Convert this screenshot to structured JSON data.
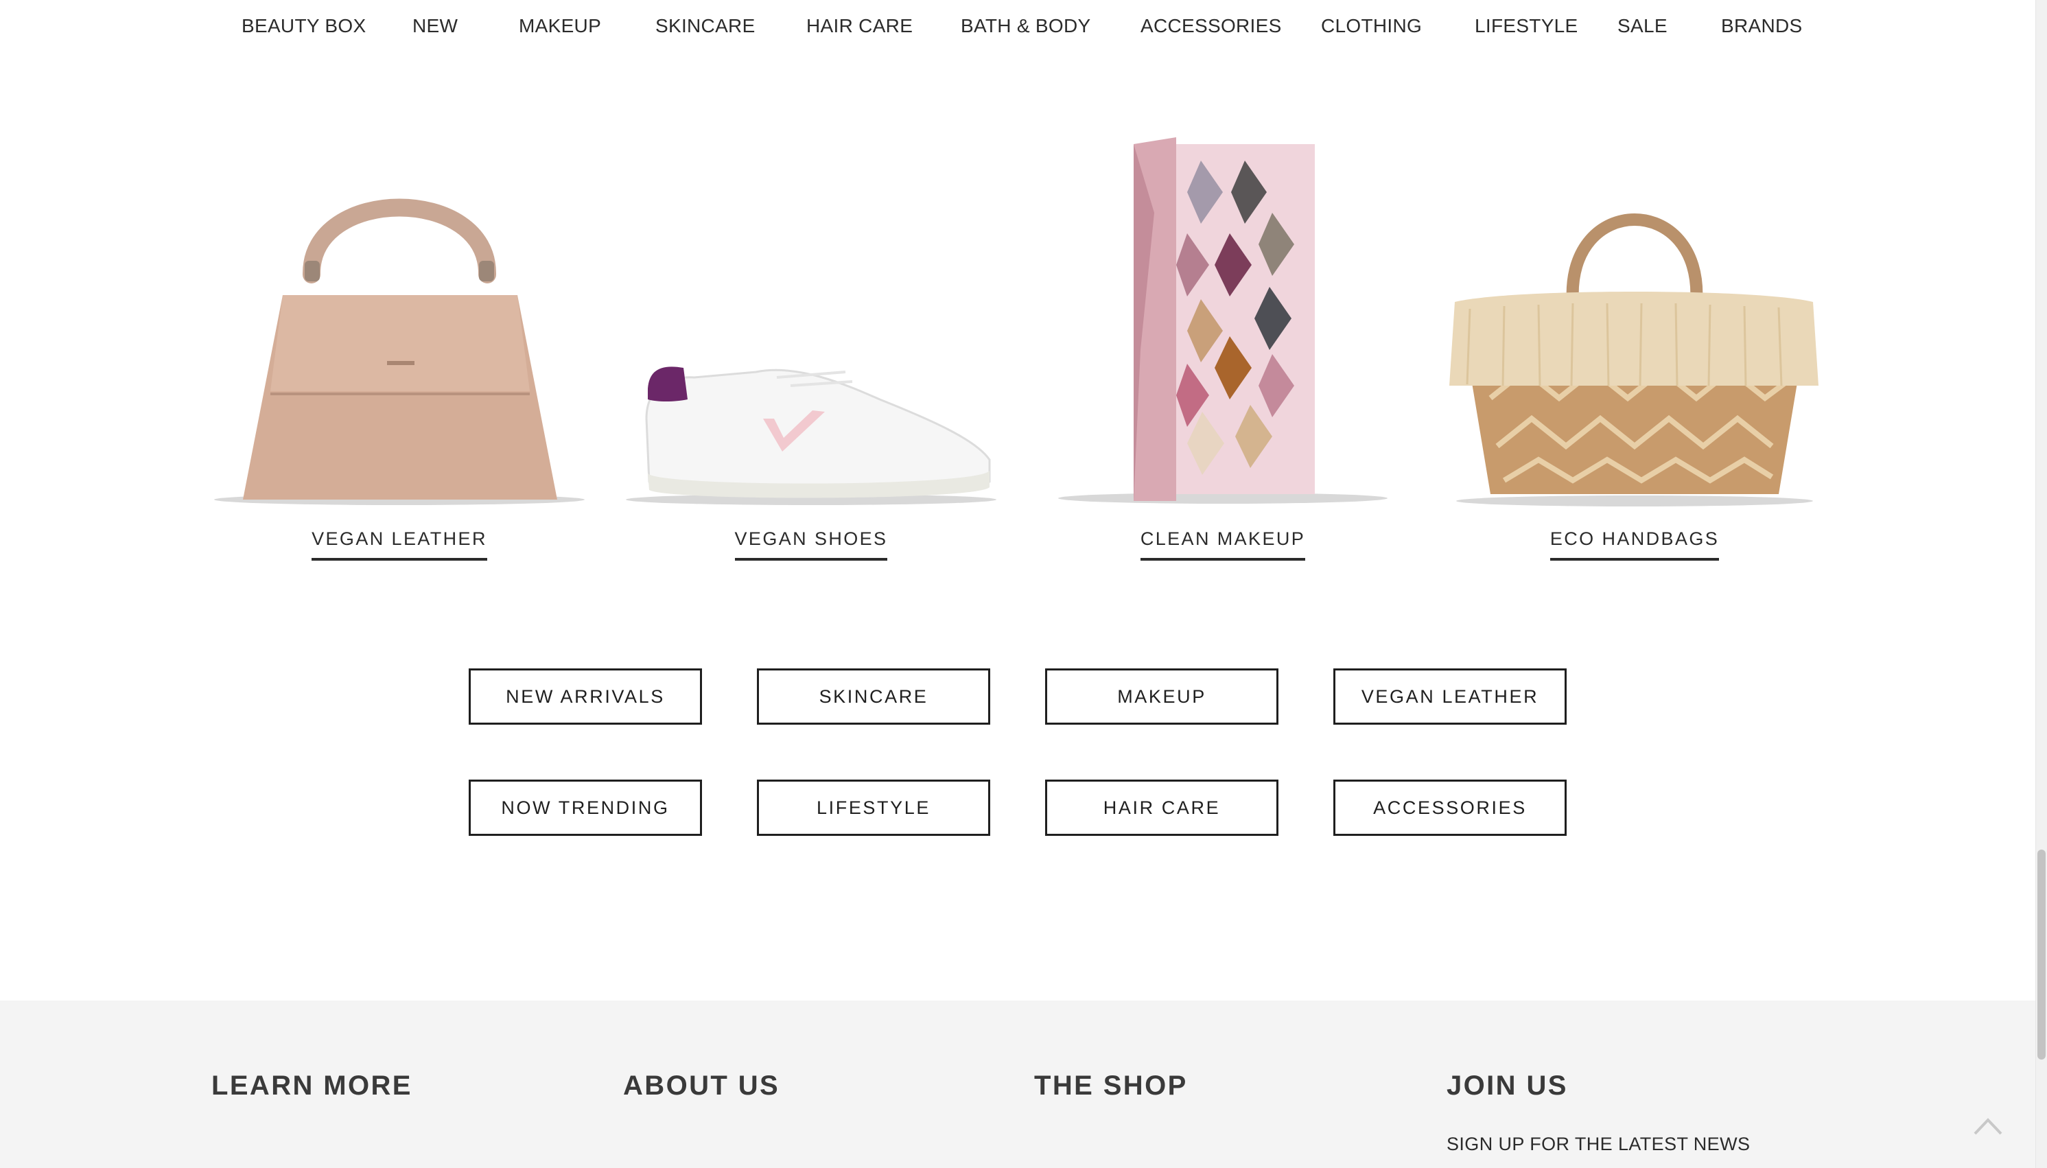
{
  "nav": {
    "items": [
      "BEAUTY BOX",
      "NEW",
      "MAKEUP",
      "SKINCARE",
      "HAIR CARE",
      "BATH & BODY",
      "ACCESSORIES",
      "CLOTHING",
      "LIFESTYLE",
      "SALE",
      "BRANDS"
    ]
  },
  "tiles": [
    {
      "label": "VEGAN LEATHER",
      "image": "tan-handbag"
    },
    {
      "label": "VEGAN SHOES",
      "image": "white-sneaker"
    },
    {
      "label": "CLEAN MAKEUP",
      "image": "eyeshadow-palette"
    },
    {
      "label": "ECO HANDBAGS",
      "image": "straw-fringe-basket"
    }
  ],
  "buttons": {
    "row1": [
      "NEW ARRIVALS",
      "SKINCARE",
      "MAKEUP",
      "VEGAN LEATHER"
    ],
    "row2": [
      "NOW TRENDING",
      "LIFESTYLE",
      "HAIR CARE",
      "ACCESSORIES"
    ]
  },
  "footer": {
    "columns": [
      "LEARN MORE",
      "ABOUT US",
      "THE SHOP",
      "JOIN US"
    ],
    "signup_text": "SIGN UP FOR THE LATEST NEWS"
  },
  "icons": {
    "back_to_top": "chevron-up-icon"
  },
  "colors": {
    "text": "#2b2b2b",
    "footer_bg": "#f4f4f4",
    "button_border": "#1f1f1f"
  }
}
